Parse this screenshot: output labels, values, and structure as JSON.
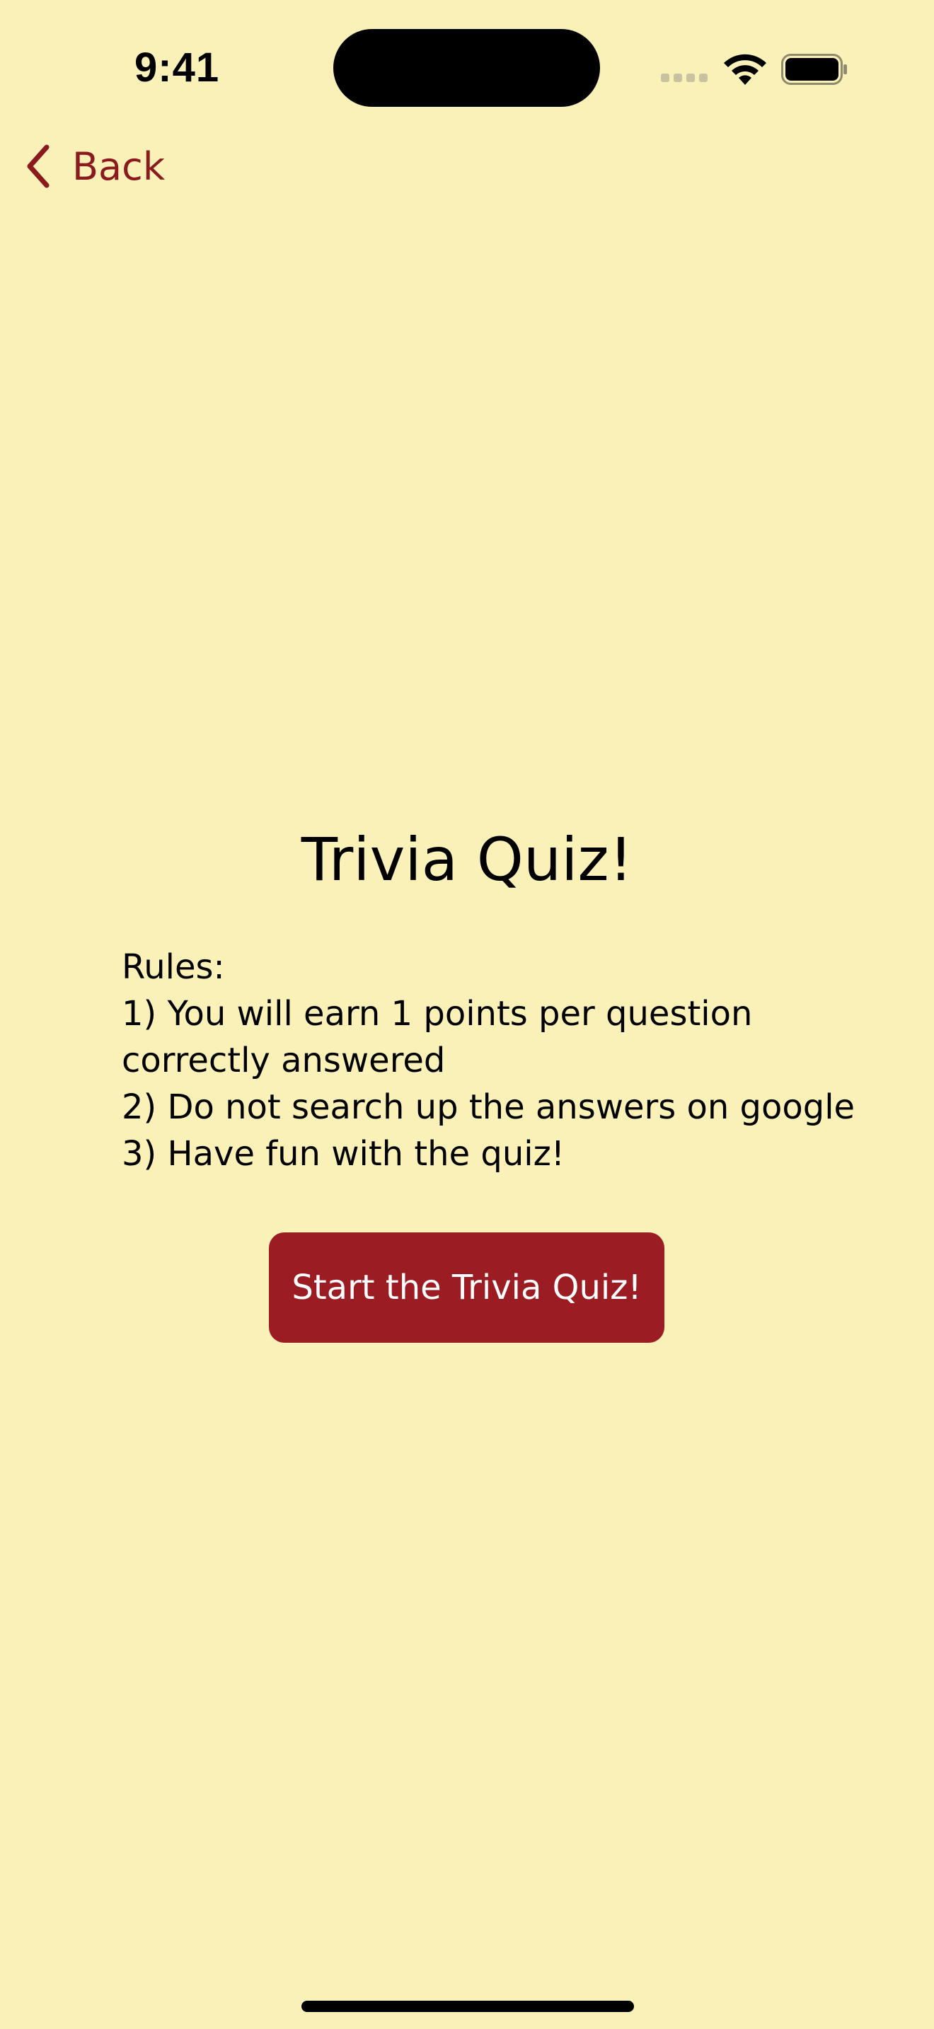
{
  "status_bar": {
    "time": "9:41"
  },
  "nav": {
    "back_label": "Back",
    "back_icon": "chevron-left-icon"
  },
  "main": {
    "title": "Trivia Quiz!",
    "rules": [
      "Rules:",
      "1) You will earn 1 points per question",
      "correctly answered",
      "2) Do not search up the answers on google",
      "3) Have fun with the quiz!"
    ],
    "start_button_label": "Start the Trivia Quiz!"
  },
  "colors": {
    "background": "#FAF1B8",
    "accent": "#8A1A1E",
    "button": "#9B1C22"
  }
}
